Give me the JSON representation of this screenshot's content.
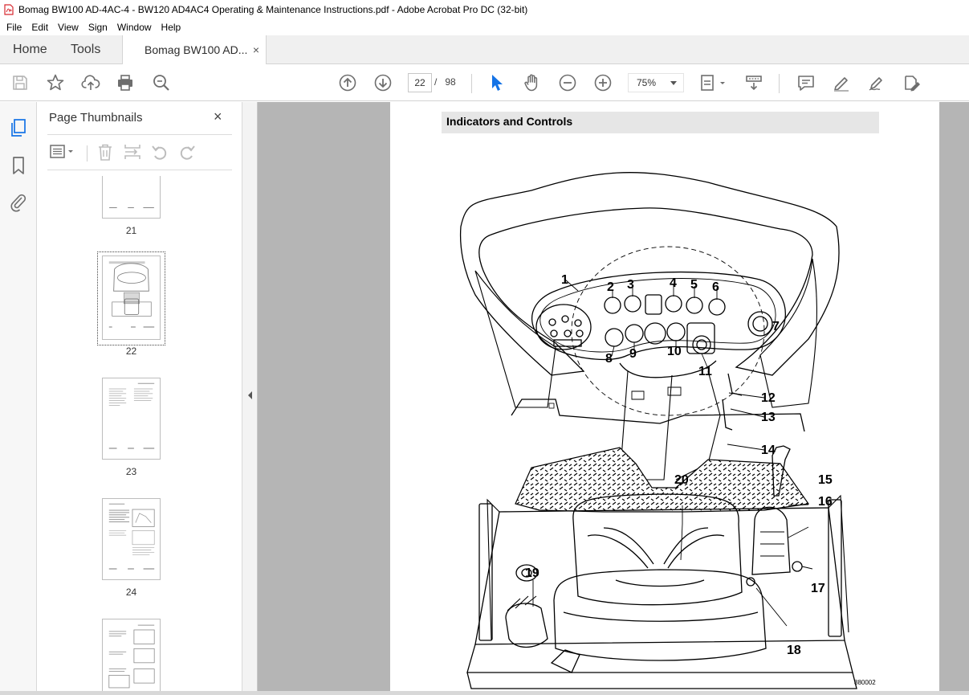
{
  "window": {
    "title": "Bomag BW100 AD-4AC-4 - BW120 AD4AC4 Operating & Maintenance Instructions.pdf - Adobe Acrobat Pro DC (32-bit)"
  },
  "menu": [
    "File",
    "Edit",
    "View",
    "Sign",
    "Window",
    "Help"
  ],
  "tabs": {
    "home": "Home",
    "tools": "Tools",
    "document": "Bomag BW100 AD...",
    "close": "×"
  },
  "toolbar": {
    "current_page": "22",
    "page_sep": "/",
    "page_count": "98",
    "zoom": "75%"
  },
  "thumbnails": {
    "title": "Page Thumbnails",
    "close": "×",
    "pages": [
      {
        "label": "21"
      },
      {
        "label": "22",
        "selected": true
      },
      {
        "label": "23"
      },
      {
        "label": "24"
      }
    ]
  },
  "document": {
    "section_heading": "Indicators and Controls",
    "figure_id": "880002",
    "callouts": [
      "1",
      "2",
      "3",
      "4",
      "5",
      "6",
      "7",
      "8",
      "9",
      "10",
      "11",
      "12",
      "13",
      "14",
      "15",
      "16",
      "17",
      "18",
      "19",
      "20"
    ]
  },
  "colors": {
    "acrobat_red": "#d7282f",
    "select_blue": "#1473e6",
    "icon_gray": "#6e6e6e"
  }
}
